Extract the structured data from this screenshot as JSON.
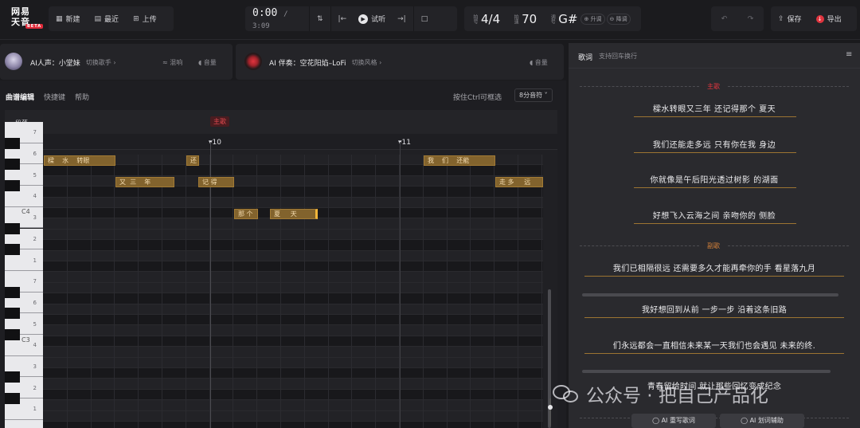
{
  "app": {
    "logo_text": "网易天音",
    "logo_badge": "BETA"
  },
  "toolbar": {
    "new_label": "新建",
    "recent_label": "最近",
    "upload_label": "上传",
    "time_current": "0:00",
    "time_sep": "/",
    "time_total": "3:09",
    "audition_label": "试听",
    "beat_label": "拍号",
    "beat_value": "4/4",
    "tempo_label": "拍速",
    "tempo_value": "70",
    "key_label": "调号",
    "key_value": "G#",
    "key_up": "升调",
    "key_down": "降调",
    "save_label": "保存",
    "export_label": "导出"
  },
  "vocal": {
    "title": "AI人声：小堂妹",
    "switch": "切换歌手",
    "reverb": "混响",
    "volume": "音量"
  },
  "accomp": {
    "title": "AI 伴奏：空花阳焰–LoFi",
    "switch": "切换风格",
    "volume": "音量"
  },
  "editor": {
    "tab_score": "曲谱编辑",
    "tab_shortcut": "快捷键",
    "tab_help": "帮助",
    "hint": "按住Ctrl可框选",
    "note_select": "8分音符",
    "section_label": "段落",
    "section_tag": "主歌",
    "bar_10": "10",
    "bar_11": "11",
    "c4_label": "C4",
    "c3_label": "C3"
  },
  "keys": {
    "labels": [
      "7",
      "6",
      "5",
      "4",
      "3",
      "2",
      "1",
      "7",
      "6",
      "5",
      "4",
      "3",
      "2",
      "1",
      "7"
    ]
  },
  "notes": [
    {
      "text": "樑    水    转眼",
      "row": 0
    },
    {
      "text": "还",
      "row": 0
    },
    {
      "text": "我    们    还能",
      "row": 0
    },
    {
      "text": "又  三    年",
      "row": 1
    },
    {
      "text": "记 得",
      "row": 1
    },
    {
      "text": "走 多     远",
      "row": 1
    },
    {
      "text": "那 个",
      "row": 2
    },
    {
      "text": "夏     天",
      "row": 2
    }
  ],
  "lyrics": {
    "header": "歌词",
    "header_sub": "支持回车换行",
    "verse_tag": "主歌",
    "chorus_tag": "副歌",
    "lines": [
      "樑水转眼又三年 还记得那个 夏天",
      "我们还能走多远 只有你在我 身边",
      "你就像是午后阳光透过树影 的湖面",
      "好想飞入云海之间 亲吻你的 侧脸"
    ],
    "chorus_lines": [
      "我们已相隔很远 还需要多久才能再牵你的手 看星落九月",
      "我好想回到从前 一步一步 沿着这条旧路",
      "们永远都会一直相信未来某一天我们也会遇见 未来的终.",
      "青春留给时间 就让那些回忆变成纪念"
    ],
    "rewrite_label": "AI 重写歌词",
    "assist_label": "AI 划词辅助"
  },
  "watermark": "公众号 · 把自己产品化",
  "colors": {
    "accent": "#e0353f",
    "note": "#82632d",
    "verse_tag": "#e0353f",
    "chorus_tag": "#d2803a"
  }
}
